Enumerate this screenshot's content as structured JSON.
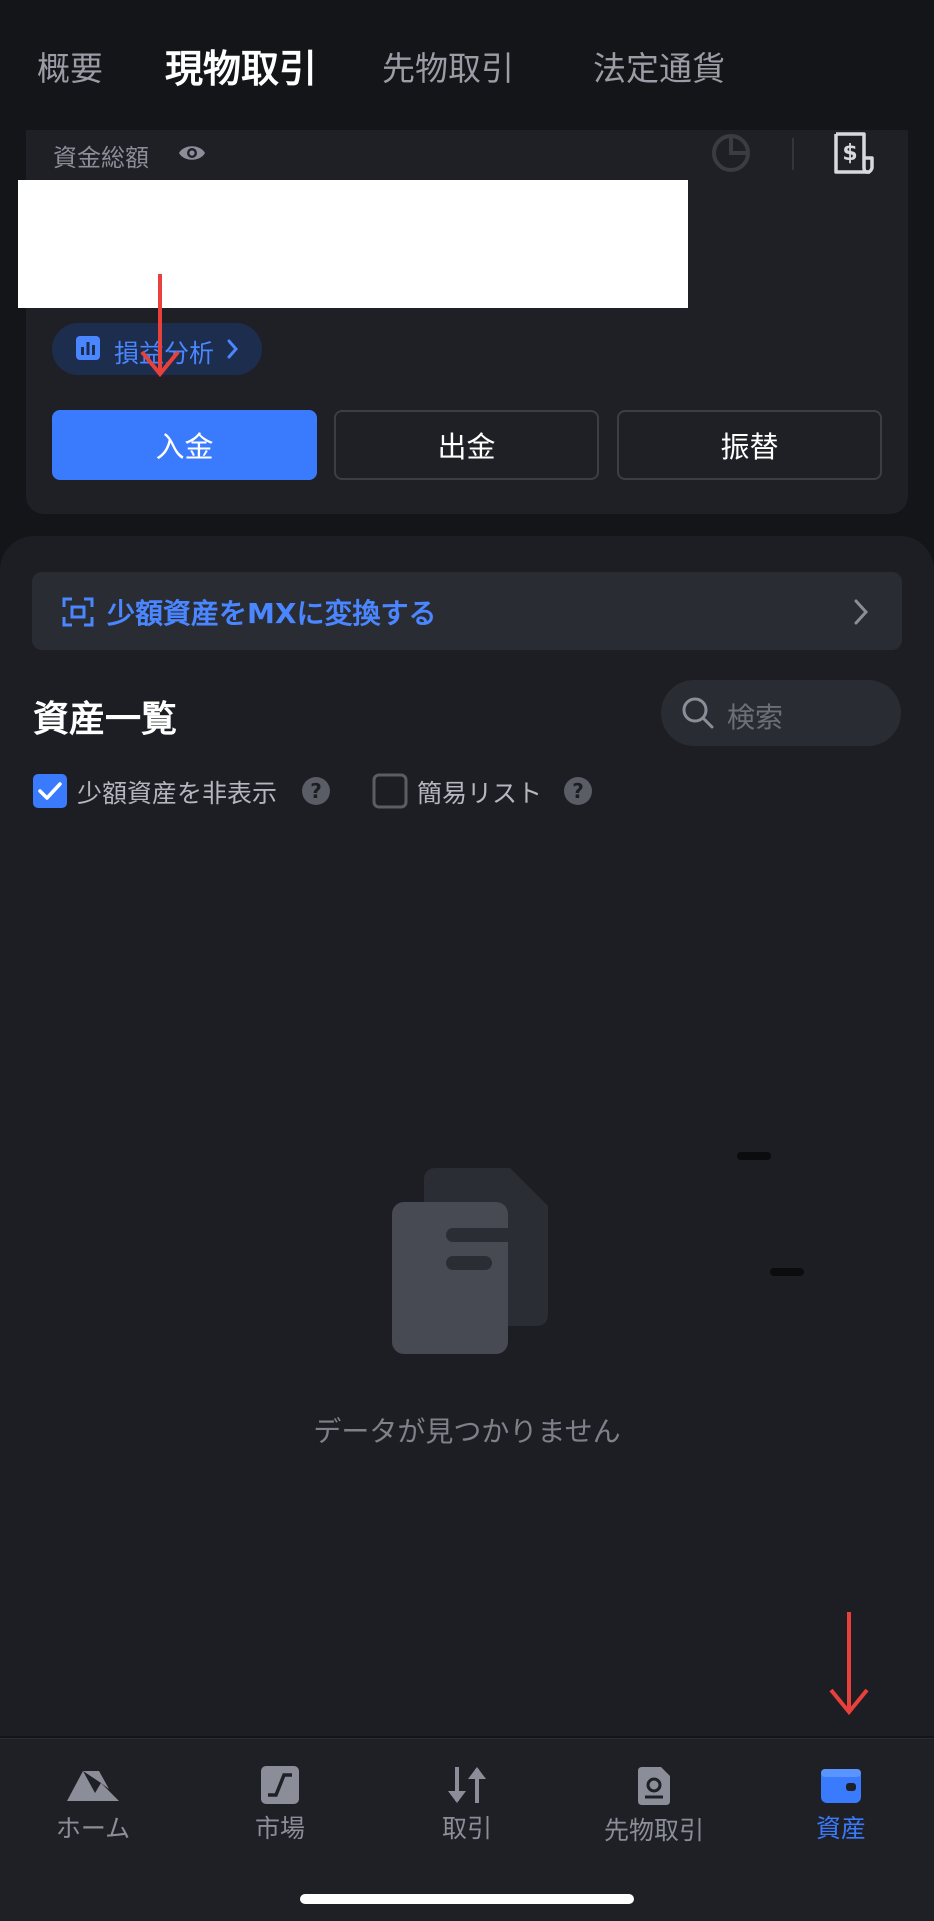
{
  "tabs": [
    "概要",
    "現物取引",
    "先物取引",
    "法定通貨"
  ],
  "active_tab": "現物取引",
  "balance": {
    "label": "資金総額"
  },
  "pnl_pill": {
    "label": "損益分析"
  },
  "actions": {
    "deposit": "入金",
    "withdraw": "出金",
    "transfer": "振替"
  },
  "banner": {
    "text": "少額資産をMXに変換する"
  },
  "assets": {
    "title": "資産一覧",
    "search_placeholder": "検索",
    "hide_small_label": "少額資産を非表示",
    "hide_small_checked": true,
    "simple_list_label": "簡易リスト",
    "simple_list_checked": false,
    "empty_text": "データが見つかりません"
  },
  "bottom_nav": [
    {
      "label": "ホーム",
      "icon": "home-icon"
    },
    {
      "label": "市場",
      "icon": "market-icon"
    },
    {
      "label": "取引",
      "icon": "trade-icon"
    },
    {
      "label": "先物取引",
      "icon": "futures-icon"
    },
    {
      "label": "資産",
      "icon": "wallet-icon",
      "active": true
    }
  ],
  "colors": {
    "accent": "#3a7bfd",
    "background": "#141518",
    "annotation_arrow": "#e8413c"
  }
}
